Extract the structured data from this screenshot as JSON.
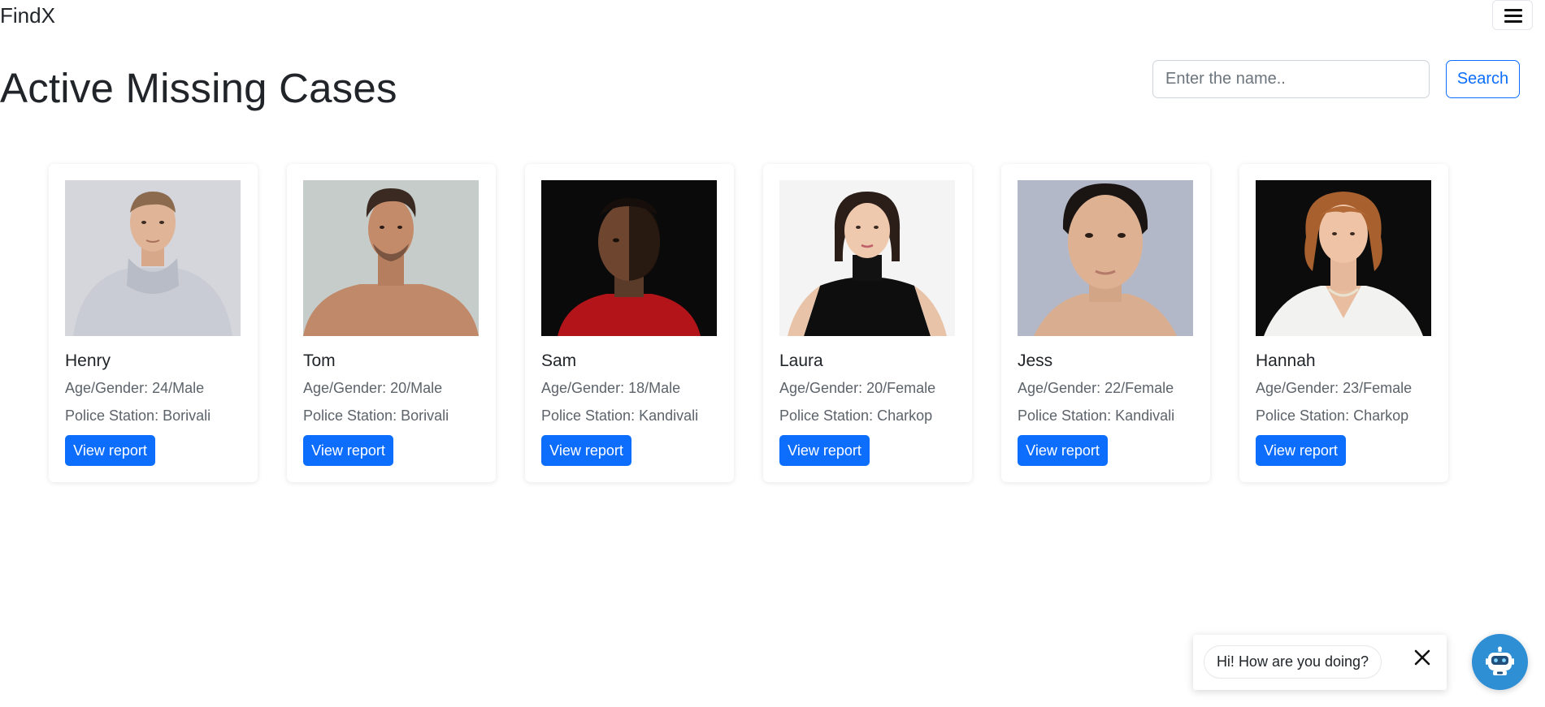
{
  "nav": {
    "brand": "FindX"
  },
  "page": {
    "title": "Active Missing Cases"
  },
  "search": {
    "placeholder": "Enter the name..",
    "value": "",
    "button_label": "Search"
  },
  "card_labels": {
    "age_gender_prefix": "Age/Gender:",
    "station_prefix": "Police Station:",
    "button_label": "View report"
  },
  "cases": [
    {
      "name": "Henry",
      "age_gender": "24/Male",
      "station": "Borivali"
    },
    {
      "name": "Tom",
      "age_gender": "20/Male",
      "station": "Borivali"
    },
    {
      "name": "Sam",
      "age_gender": "18/Male",
      "station": "Kandivali"
    },
    {
      "name": "Laura",
      "age_gender": "20/Female",
      "station": "Charkop"
    },
    {
      "name": "Jess",
      "age_gender": "22/Female",
      "station": "Kandivali"
    },
    {
      "name": "Hannah",
      "age_gender": "23/Female",
      "station": "Charkop"
    }
  ],
  "chat": {
    "message": "Hi! How are you doing?"
  },
  "colors": {
    "primary": "#0d6efd",
    "bot": "#2f8fd5"
  },
  "icons": {
    "menu": "hamburger-menu-icon",
    "close": "close-icon",
    "bot": "robot-icon"
  }
}
